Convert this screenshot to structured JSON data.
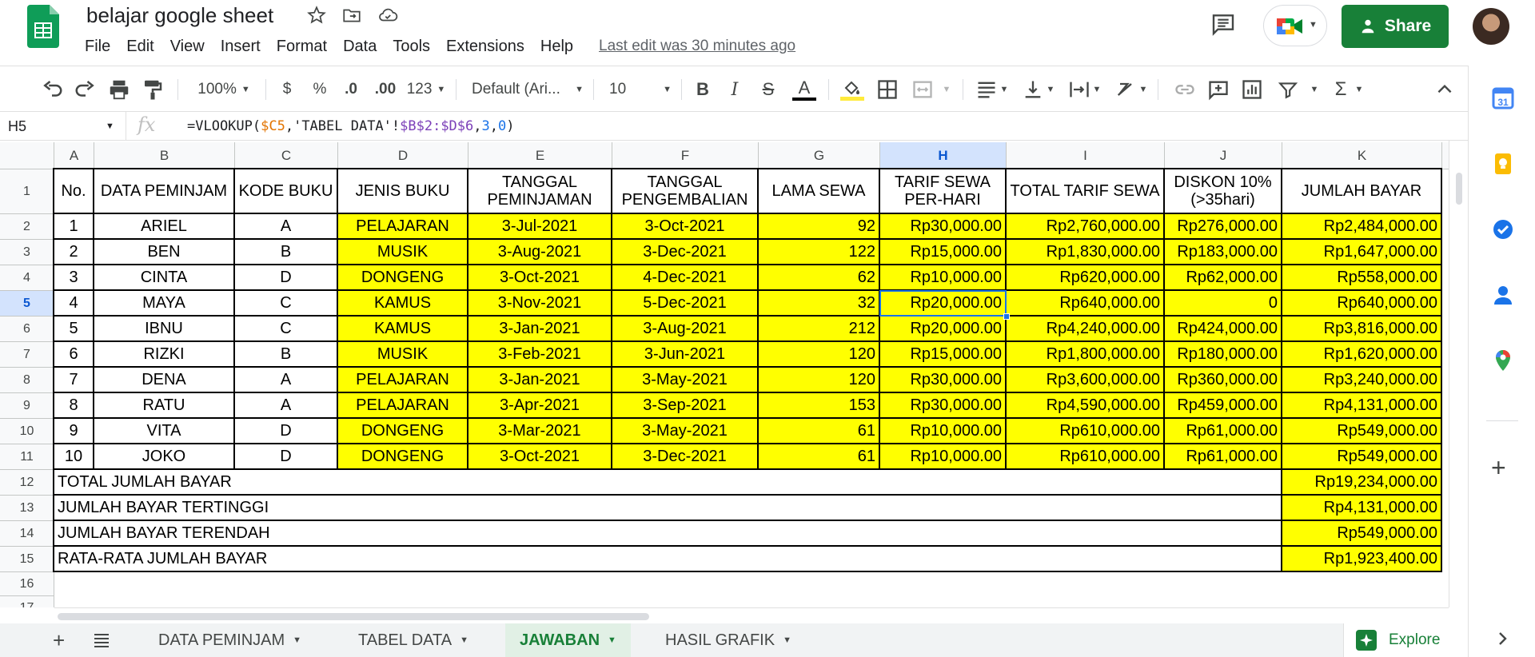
{
  "app": {
    "doc_title": "belajar google sheet",
    "menu": [
      "File",
      "Edit",
      "View",
      "Insert",
      "Format",
      "Data",
      "Tools",
      "Extensions",
      "Help"
    ],
    "last_edit": "Last edit was 30 minutes ago",
    "share_label": "Share"
  },
  "toolbar": {
    "zoom": "100%",
    "currency": "$",
    "percent": "%",
    "decrease_decimal": ".0",
    "increase_decimal": ".00",
    "more_formats": "123",
    "font": "Default (Ari...",
    "font_size": "10",
    "bold": "B",
    "italic": "I",
    "strike": "S",
    "text_color_glyph": "A",
    "text_color": "#000000",
    "fill_color": "#ffeb3b"
  },
  "formula_bar": {
    "cell_ref": "H5",
    "fx": "fx",
    "formula_prefix": "=VLOOKUP(",
    "formula_ref1": "$C5",
    "formula_mid": ",'TABEL DATA'!",
    "formula_ref2": "$B$2:$D$6",
    "formula_comma": ",",
    "formula_num1": "3",
    "formula_comma2": ",",
    "formula_num2": "0",
    "formula_close": ")"
  },
  "grid": {
    "columns": [
      "A",
      "B",
      "C",
      "D",
      "E",
      "F",
      "G",
      "H",
      "I",
      "J",
      "K"
    ],
    "rows": [
      "1",
      "2",
      "3",
      "4",
      "5",
      "6",
      "7",
      "8",
      "9",
      "10",
      "11",
      "12",
      "13",
      "14",
      "15",
      "16",
      "17"
    ],
    "selected_column": "H",
    "selected_row": "5",
    "headers": [
      "No.",
      "DATA PEMINJAM",
      "KODE BUKU",
      "JENIS BUKU",
      "TANGGAL PEMINJAMAN",
      "TANGGAL PENGEMBALIAN",
      "LAMA SEWA",
      "TARIF SEWA PER-HARI",
      "TOTAL TARIF SEWA",
      "DISKON 10% (>35hari)",
      "JUMLAH BAYAR"
    ],
    "data_rows": [
      [
        "1",
        "ARIEL",
        "A",
        "PELAJARAN",
        "3-Jul-2021",
        "3-Oct-2021",
        "92",
        "Rp30,000.00",
        "Rp2,760,000.00",
        "Rp276,000.00",
        "Rp2,484,000.00"
      ],
      [
        "2",
        "BEN",
        "B",
        "MUSIK",
        "3-Aug-2021",
        "3-Dec-2021",
        "122",
        "Rp15,000.00",
        "Rp1,830,000.00",
        "Rp183,000.00",
        "Rp1,647,000.00"
      ],
      [
        "3",
        "CINTA",
        "D",
        "DONGENG",
        "3-Oct-2021",
        "4-Dec-2021",
        "62",
        "Rp10,000.00",
        "Rp620,000.00",
        "Rp62,000.00",
        "Rp558,000.00"
      ],
      [
        "4",
        "MAYA",
        "C",
        "KAMUS",
        "3-Nov-2021",
        "5-Dec-2021",
        "32",
        "Rp20,000.00",
        "Rp640,000.00",
        "0",
        "Rp640,000.00"
      ],
      [
        "5",
        "IBNU",
        "C",
        "KAMUS",
        "3-Jan-2021",
        "3-Aug-2021",
        "212",
        "Rp20,000.00",
        "Rp4,240,000.00",
        "Rp424,000.00",
        "Rp3,816,000.00"
      ],
      [
        "6",
        "RIZKI",
        "B",
        "MUSIK",
        "3-Feb-2021",
        "3-Jun-2021",
        "120",
        "Rp15,000.00",
        "Rp1,800,000.00",
        "Rp180,000.00",
        "Rp1,620,000.00"
      ],
      [
        "7",
        "DENA",
        "A",
        "PELAJARAN",
        "3-Jan-2021",
        "3-May-2021",
        "120",
        "Rp30,000.00",
        "Rp3,600,000.00",
        "Rp360,000.00",
        "Rp3,240,000.00"
      ],
      [
        "8",
        "RATU",
        "A",
        "PELAJARAN",
        "3-Apr-2021",
        "3-Sep-2021",
        "153",
        "Rp30,000.00",
        "Rp4,590,000.00",
        "Rp459,000.00",
        "Rp4,131,000.00"
      ],
      [
        "9",
        "VITA",
        "D",
        "DONGENG",
        "3-Mar-2021",
        "3-May-2021",
        "61",
        "Rp10,000.00",
        "Rp610,000.00",
        "Rp61,000.00",
        "Rp549,000.00"
      ],
      [
        "10",
        "JOKO",
        "D",
        "DONGENG",
        "3-Oct-2021",
        "3-Dec-2021",
        "61",
        "Rp10,000.00",
        "Rp610,000.00",
        "Rp61,000.00",
        "Rp549,000.00"
      ]
    ],
    "summary_rows": [
      [
        "TOTAL JUMLAH BAYAR",
        "Rp19,234,000.00"
      ],
      [
        "JUMLAH BAYAR TERTINGGI",
        "Rp4,131,000.00"
      ],
      [
        "JUMLAH BAYAR TERENDAH",
        "Rp549,000.00"
      ],
      [
        "RATA-RATA JUMLAH BAYAR",
        "Rp1,923,400.00"
      ]
    ]
  },
  "sheets": {
    "tabs": [
      "DATA PEMINJAM",
      "TABEL DATA",
      "JAWABAN",
      "HASIL GRAFIK"
    ],
    "active": "JAWABAN",
    "explore_label": "Explore"
  },
  "colors": {
    "highlight": "#ffff00",
    "brand_green": "#188038",
    "selection_blue": "#1a73e8"
  }
}
